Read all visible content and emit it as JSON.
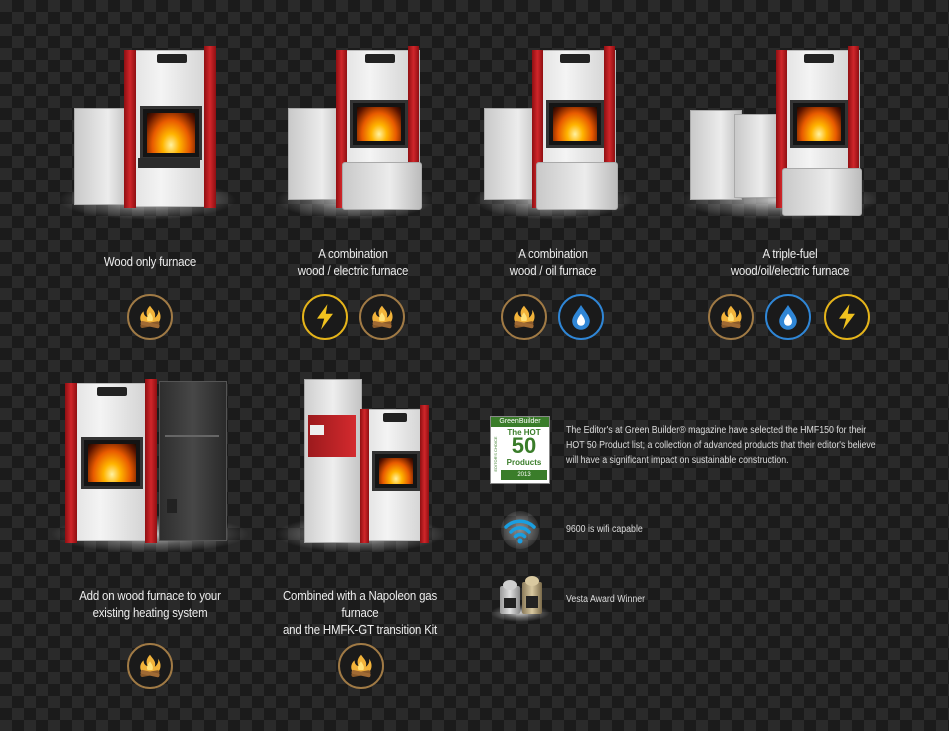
{
  "products": [
    {
      "caption_lines": [
        "Wood only furnace"
      ],
      "icons": [
        "wood-fire-icon"
      ]
    },
    {
      "caption_lines": [
        "A combination",
        "wood / electric furnace"
      ],
      "icons": [
        "lightning-icon",
        "wood-fire-icon"
      ]
    },
    {
      "caption_lines": [
        "A combination",
        "wood / oil furnace"
      ],
      "icons": [
        "wood-fire-icon",
        "oil-drop-icon"
      ]
    },
    {
      "caption_lines": [
        "A triple-fuel",
        "wood/oil/electric furnace"
      ],
      "icons": [
        "wood-fire-icon",
        "oil-drop-icon",
        "lightning-icon"
      ]
    },
    {
      "caption_lines": [
        "Add on wood furnace to your",
        "existing heating system"
      ],
      "icons": [
        "wood-fire-icon"
      ]
    },
    {
      "caption_lines": [
        "Combined with a Napoleon gas furnace",
        "and the HMFK-GT transition Kit"
      ],
      "icons": [
        "wood-fire-icon"
      ]
    }
  ],
  "features": [
    {
      "badge_icon": "green-builder-hot50-badge",
      "badge_text": {
        "brand": "GreenBuilder",
        "line1": "The HOT",
        "number": "50",
        "line2": "Products",
        "year": "2013",
        "side": "EDITOR'S CHOICE"
      },
      "text": "The Editor's at Green Builder® magazine have selected the HMF150 for their HOT 50 Product list; a collection of advanced products that their editor's believe will have a significant impact on sustainable construction."
    },
    {
      "badge_icon": "wifi-icon",
      "text": "9600 is wifi capable"
    },
    {
      "badge_icon": "vesta-award-icon",
      "text": "Vesta Award Winner"
    }
  ],
  "colors": {
    "wood": "#a07a45",
    "electric": "#e5b41a",
    "oil": "#2f86d6",
    "brand_red": "#c8202a"
  }
}
